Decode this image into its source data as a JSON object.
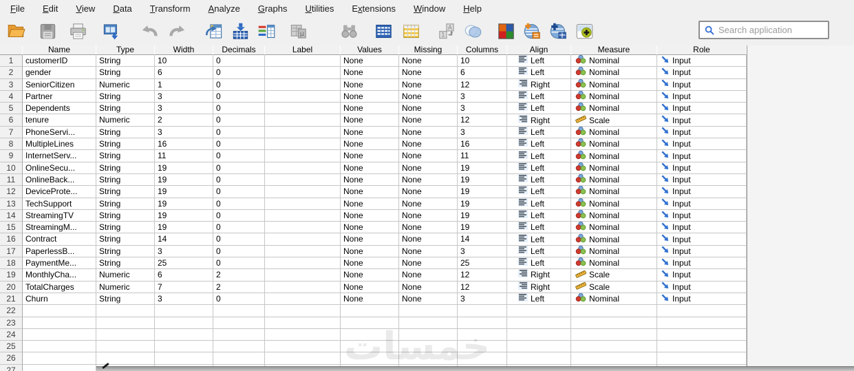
{
  "menubar": {
    "items": [
      {
        "pre": "",
        "key": "F",
        "post": "ile"
      },
      {
        "pre": "",
        "key": "E",
        "post": "dit"
      },
      {
        "pre": "",
        "key": "V",
        "post": "iew"
      },
      {
        "pre": "",
        "key": "D",
        "post": "ata"
      },
      {
        "pre": "",
        "key": "T",
        "post": "ransform"
      },
      {
        "pre": "",
        "key": "A",
        "post": "nalyze"
      },
      {
        "pre": "",
        "key": "G",
        "post": "raphs"
      },
      {
        "pre": "",
        "key": "U",
        "post": "tilities"
      },
      {
        "pre": "E",
        "key": "x",
        "post": "tensions"
      },
      {
        "pre": "",
        "key": "W",
        "post": "indow"
      },
      {
        "pre": "",
        "key": "H",
        "post": "elp"
      }
    ]
  },
  "toolbar": {
    "search_placeholder": "Search application",
    "buttons": [
      {
        "name": "open-data",
        "disabled": false
      },
      {
        "name": "save",
        "disabled": true
      },
      {
        "name": "print",
        "disabled": false
      },
      {
        "name": "recall-dialogs",
        "disabled": false
      },
      {
        "name": "undo",
        "disabled": true
      },
      {
        "name": "redo",
        "disabled": true
      },
      {
        "name": "goto-case",
        "disabled": false
      },
      {
        "name": "goto-variable",
        "disabled": false
      },
      {
        "name": "variables",
        "disabled": false
      },
      {
        "name": "run-descriptives",
        "disabled": true
      },
      {
        "name": "find",
        "disabled": true
      },
      {
        "name": "split-file",
        "disabled": false
      },
      {
        "name": "insert-variable",
        "disabled": false
      },
      {
        "name": "value-labels",
        "disabled": true
      },
      {
        "name": "use-variable-sets",
        "disabled": false
      },
      {
        "name": "select-cases",
        "disabled": false
      },
      {
        "name": "custom-dialogs",
        "disabled": false
      },
      {
        "name": "custom-tables",
        "disabled": false
      },
      {
        "name": "extension-hub",
        "disabled": false
      }
    ]
  },
  "table": {
    "columns": [
      "Name",
      "Type",
      "Width",
      "Decimals",
      "Label",
      "Values",
      "Missing",
      "Columns",
      "Align",
      "Measure",
      "Role"
    ],
    "rows": [
      {
        "num": "1",
        "name": "customerID",
        "type": "String",
        "width": "10",
        "decimals": "0",
        "label": "",
        "values": "None",
        "missing": "None",
        "columns": "10",
        "align": "Left",
        "measure": "Nominal",
        "role": "Input"
      },
      {
        "num": "2",
        "name": "gender",
        "type": "String",
        "width": "6",
        "decimals": "0",
        "label": "",
        "values": "None",
        "missing": "None",
        "columns": "6",
        "align": "Left",
        "measure": "Nominal",
        "role": "Input"
      },
      {
        "num": "3",
        "name": "SeniorCitizen",
        "type": "Numeric",
        "width": "1",
        "decimals": "0",
        "label": "",
        "values": "None",
        "missing": "None",
        "columns": "12",
        "align": "Right",
        "measure": "Nominal",
        "role": "Input"
      },
      {
        "num": "4",
        "name": "Partner",
        "type": "String",
        "width": "3",
        "decimals": "0",
        "label": "",
        "values": "None",
        "missing": "None",
        "columns": "3",
        "align": "Left",
        "measure": "Nominal",
        "role": "Input"
      },
      {
        "num": "5",
        "name": "Dependents",
        "type": "String",
        "width": "3",
        "decimals": "0",
        "label": "",
        "values": "None",
        "missing": "None",
        "columns": "3",
        "align": "Left",
        "measure": "Nominal",
        "role": "Input"
      },
      {
        "num": "6",
        "name": "tenure",
        "type": "Numeric",
        "width": "2",
        "decimals": "0",
        "label": "",
        "values": "None",
        "missing": "None",
        "columns": "12",
        "align": "Right",
        "measure": "Scale",
        "role": "Input"
      },
      {
        "num": "7",
        "name": "PhoneServi...",
        "type": "String",
        "width": "3",
        "decimals": "0",
        "label": "",
        "values": "None",
        "missing": "None",
        "columns": "3",
        "align": "Left",
        "measure": "Nominal",
        "role": "Input"
      },
      {
        "num": "8",
        "name": "MultipleLines",
        "type": "String",
        "width": "16",
        "decimals": "0",
        "label": "",
        "values": "None",
        "missing": "None",
        "columns": "16",
        "align": "Left",
        "measure": "Nominal",
        "role": "Input"
      },
      {
        "num": "9",
        "name": "InternetServ...",
        "type": "String",
        "width": "11",
        "decimals": "0",
        "label": "",
        "values": "None",
        "missing": "None",
        "columns": "11",
        "align": "Left",
        "measure": "Nominal",
        "role": "Input"
      },
      {
        "num": "10",
        "name": "OnlineSecu...",
        "type": "String",
        "width": "19",
        "decimals": "0",
        "label": "",
        "values": "None",
        "missing": "None",
        "columns": "19",
        "align": "Left",
        "measure": "Nominal",
        "role": "Input"
      },
      {
        "num": "11",
        "name": "OnlineBack...",
        "type": "String",
        "width": "19",
        "decimals": "0",
        "label": "",
        "values": "None",
        "missing": "None",
        "columns": "19",
        "align": "Left",
        "measure": "Nominal",
        "role": "Input"
      },
      {
        "num": "12",
        "name": "DeviceProte...",
        "type": "String",
        "width": "19",
        "decimals": "0",
        "label": "",
        "values": "None",
        "missing": "None",
        "columns": "19",
        "align": "Left",
        "measure": "Nominal",
        "role": "Input"
      },
      {
        "num": "13",
        "name": "TechSupport",
        "type": "String",
        "width": "19",
        "decimals": "0",
        "label": "",
        "values": "None",
        "missing": "None",
        "columns": "19",
        "align": "Left",
        "measure": "Nominal",
        "role": "Input"
      },
      {
        "num": "14",
        "name": "StreamingTV",
        "type": "String",
        "width": "19",
        "decimals": "0",
        "label": "",
        "values": "None",
        "missing": "None",
        "columns": "19",
        "align": "Left",
        "measure": "Nominal",
        "role": "Input"
      },
      {
        "num": "15",
        "name": "StreamingM...",
        "type": "String",
        "width": "19",
        "decimals": "0",
        "label": "",
        "values": "None",
        "missing": "None",
        "columns": "19",
        "align": "Left",
        "measure": "Nominal",
        "role": "Input"
      },
      {
        "num": "16",
        "name": "Contract",
        "type": "String",
        "width": "14",
        "decimals": "0",
        "label": "",
        "values": "None",
        "missing": "None",
        "columns": "14",
        "align": "Left",
        "measure": "Nominal",
        "role": "Input"
      },
      {
        "num": "17",
        "name": "PaperlessB...",
        "type": "String",
        "width": "3",
        "decimals": "0",
        "label": "",
        "values": "None",
        "missing": "None",
        "columns": "3",
        "align": "Left",
        "measure": "Nominal",
        "role": "Input"
      },
      {
        "num": "18",
        "name": "PaymentMe...",
        "type": "String",
        "width": "25",
        "decimals": "0",
        "label": "",
        "values": "None",
        "missing": "None",
        "columns": "25",
        "align": "Left",
        "measure": "Nominal",
        "role": "Input"
      },
      {
        "num": "19",
        "name": "MonthlyCha...",
        "type": "Numeric",
        "width": "6",
        "decimals": "2",
        "label": "",
        "values": "None",
        "missing": "None",
        "columns": "12",
        "align": "Right",
        "measure": "Scale",
        "role": "Input"
      },
      {
        "num": "20",
        "name": "TotalCharges",
        "type": "Numeric",
        "width": "7",
        "decimals": "2",
        "label": "",
        "values": "None",
        "missing": "None",
        "columns": "12",
        "align": "Right",
        "measure": "Scale",
        "role": "Input"
      },
      {
        "num": "21",
        "name": "Churn",
        "type": "String",
        "width": "3",
        "decimals": "0",
        "label": "",
        "values": "None",
        "missing": "None",
        "columns": "3",
        "align": "Left",
        "measure": "Nominal",
        "role": "Input"
      }
    ],
    "empty_rows": [
      "22",
      "23",
      "24",
      "25",
      "26",
      "27"
    ]
  },
  "watermark": "خمسات",
  "colors": {
    "toolbar_bg": "#f0f0f0",
    "header_bg": "#f1f1f1",
    "grid_line": "#c6c6c6",
    "accent_blue": "#2e6fd0",
    "folder_orange": "#f0a132",
    "nominal_red": "#d23a2e",
    "nominal_green": "#8cc152",
    "nominal_blue": "#7da7d8",
    "scale_yellow": "#f3b73c"
  }
}
